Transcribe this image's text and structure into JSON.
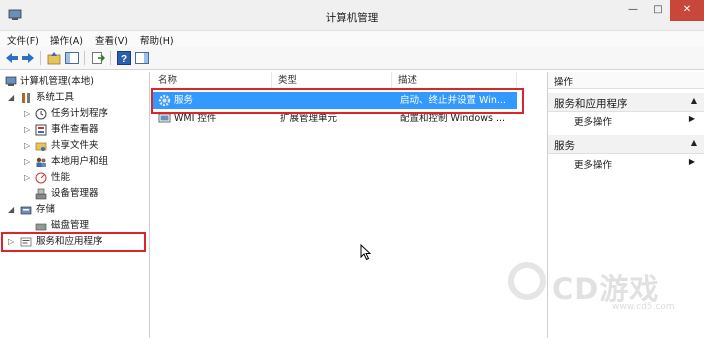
{
  "window": {
    "title": "计算机管理",
    "min_symbol": "—",
    "max_symbol": "□",
    "close_symbol": "✕"
  },
  "menu": [
    "文件(F)",
    "操作(A)",
    "查看(V)",
    "帮助(H)"
  ],
  "toolbar": {
    "buttons": [
      "back-icon",
      "forward-icon",
      "up-icon",
      "show-hide-tree-icon",
      "export-icon",
      "help-icon",
      "action-pane-icon"
    ]
  },
  "tree": {
    "root": "计算机管理(本地)",
    "system_tools": "系统工具",
    "task_scheduler": "任务计划程序",
    "event_viewer": "事件查看器",
    "shared_folders": "共享文件夹",
    "local_users": "本地用户和组",
    "performance": "性能",
    "device_manager": "设备管理器",
    "storage": "存储",
    "disk_management": "磁盘管理",
    "services_apps": "服务和应用程序"
  },
  "list": {
    "columns": [
      "名称",
      "类型",
      "描述"
    ],
    "rows": [
      {
        "name": "服务",
        "type": "",
        "desc": "启动、终止并设置 Win..."
      },
      {
        "name": "WMI 控件",
        "type": "扩展管理单元",
        "desc": "配置和控制 Windows ..."
      }
    ]
  },
  "actions": {
    "header": "操作",
    "section1": "服务和应用程序",
    "section1_more": "更多操作",
    "section2": "服务",
    "section2_more": "更多操作"
  },
  "watermark": {
    "text": "CD游戏",
    "url": "www.cd5.com"
  },
  "colors": {
    "selection": "#3399ff",
    "highlight_box": "#d9252c",
    "close_button": "#c7473b"
  }
}
